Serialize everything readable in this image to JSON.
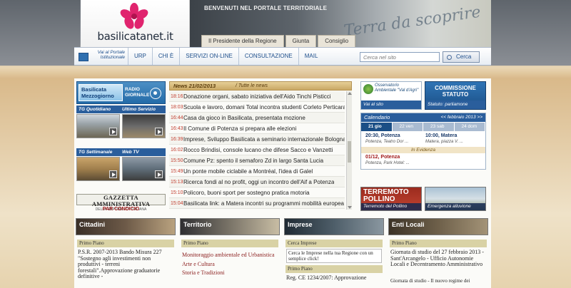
{
  "header": {
    "logo_text": "basilicatanet.it",
    "banner_title": "BENVENUTI NEL PORTALE TERRITORIALE",
    "banner_script": "Terra da scoprire",
    "top_tabs": [
      "Il Presidente della Regione",
      "Giunta",
      "Consiglio"
    ]
  },
  "nav": {
    "portal_label": "Vai al Portale Istituzionale",
    "items": [
      "URP",
      "CHI È",
      "SERVIZI ON-LINE",
      "CONSULTAZIONE",
      "MAIL"
    ],
    "search_placeholder": "Cerca nel sito",
    "search_button": "Cerca"
  },
  "left": {
    "radio_logo_line1": "Basilicata",
    "radio_logo_line2": "Mezzogiorno",
    "radio_label_line1": "RADIO",
    "radio_label_line2": "GIORNALE",
    "tg_quotidiano": "TG Quotidiano",
    "ultimo_servizio": "Ultimo Servizio",
    "tg_settimanale": "TG Settimanale",
    "web_tv": "Web TV",
    "gazzetta_title": "GAZZETTA AMMINISTRATIVA",
    "gazzetta_sub": "DELLA REPUBBLICA ITALIANA",
    "par_condicio": "PAR CONDICIO"
  },
  "news": {
    "date_label": "News 21/02/2013",
    "all_news": "/ Tutte le news",
    "items": [
      {
        "time": "18:16",
        "text": "Donazione organi, sabato iniziativa dell'Aido Tinchi Pisticci"
      },
      {
        "time": "18:03",
        "text": "Scuola e lavoro, domani Total incontra studenti Corleto Perticara"
      },
      {
        "time": "16:44",
        "text": "Casa da gioco in Basilicata, presentata mozione"
      },
      {
        "time": "16:43",
        "text": "Il Comune di Potenza si prepara alle elezioni"
      },
      {
        "time": "16:39",
        "text": "Imprese, Sviluppo Basilicata a seminario internazionale Bologna"
      },
      {
        "time": "16:02",
        "text": "Rocco Brindisi, console lucano che difese Sacco e Vanzetti"
      },
      {
        "time": "15:50",
        "text": "Comune Pz: spento il semaforo Zd in largo Santa Lucia"
      },
      {
        "time": "15:49",
        "text": "Un ponte mobile ciclabile a Montréal, l'idea di Galel"
      },
      {
        "time": "15:13",
        "text": "Ricerca fondi al no profit, oggi un incontro dell'Aif a Potenza"
      },
      {
        "time": "15:10",
        "text": "Policoro, buoni sport per sostegno pratica motoria"
      },
      {
        "time": "15:04",
        "text": "Basilicata link: a Matera incontri su programmi mobilità europea"
      }
    ]
  },
  "right": {
    "oss_title": "Osservatorio Ambientale \"Val d'Agri\"",
    "oss_link": "Vai al sito",
    "comm_title_1": "COMMISSIONE",
    "comm_title_2": "STATUTO",
    "comm_link": "Statuto: parliamone",
    "cal_title": "Calendario",
    "cal_month": "<< febbraio 2013 >>",
    "cal_days": [
      "21 gio",
      "22 ven",
      "23 sab",
      "24 dom"
    ],
    "cal_events": [
      {
        "title": "20:30, Potenza",
        "place": "Potenza, Teatro Dor ..."
      },
      {
        "title": "10:00, Matera",
        "place": "Matera, piazza V. ..."
      }
    ],
    "in_evidenza": "In Evidenza",
    "evid_event": {
      "title": "01/12, Potenza",
      "place": "Potenza, Park Hotel: ..."
    },
    "terr_title_1": "TERREMOTO",
    "terr_title_2": "POLLINO",
    "terr_link": "Terremoto del Pollino",
    "emerg_link": "Emergenza alluvione"
  },
  "sections": {
    "cittadini": {
      "title": "Cittadini",
      "sub": "Primo Piano",
      "text": "P.S.R. 2007-2013 Bando Misura 227 \"Sostegno agli investimenti non produttivi - terreni forestali\".Approvazione graduatorie definitive -"
    },
    "territorio": {
      "title": "Territorio",
      "sub": "Primo Piano",
      "links": [
        "Monitoraggio ambientale ed Urbanistica",
        "Arte e Cultura",
        "Storia e Tradizioni"
      ]
    },
    "imprese": {
      "title": "Imprese",
      "sub1": "Cerca Imprese",
      "box": "Cerca le Imprese nella tua Regione con un semplice click!",
      "sub2": "Primo Piano",
      "text": "Reg. CE 1234/2007: Approvazione"
    },
    "enti": {
      "title": "Enti Locali",
      "sub": "Primo Piano",
      "text": "Giornata di studio del 27 febbraio 2013 - Sant'Arcangelo - Ufficio Autonomie Locali e Decentramento Amministrativo",
      "extra": "Giornata di studio - Il nuovo regime dei"
    }
  }
}
